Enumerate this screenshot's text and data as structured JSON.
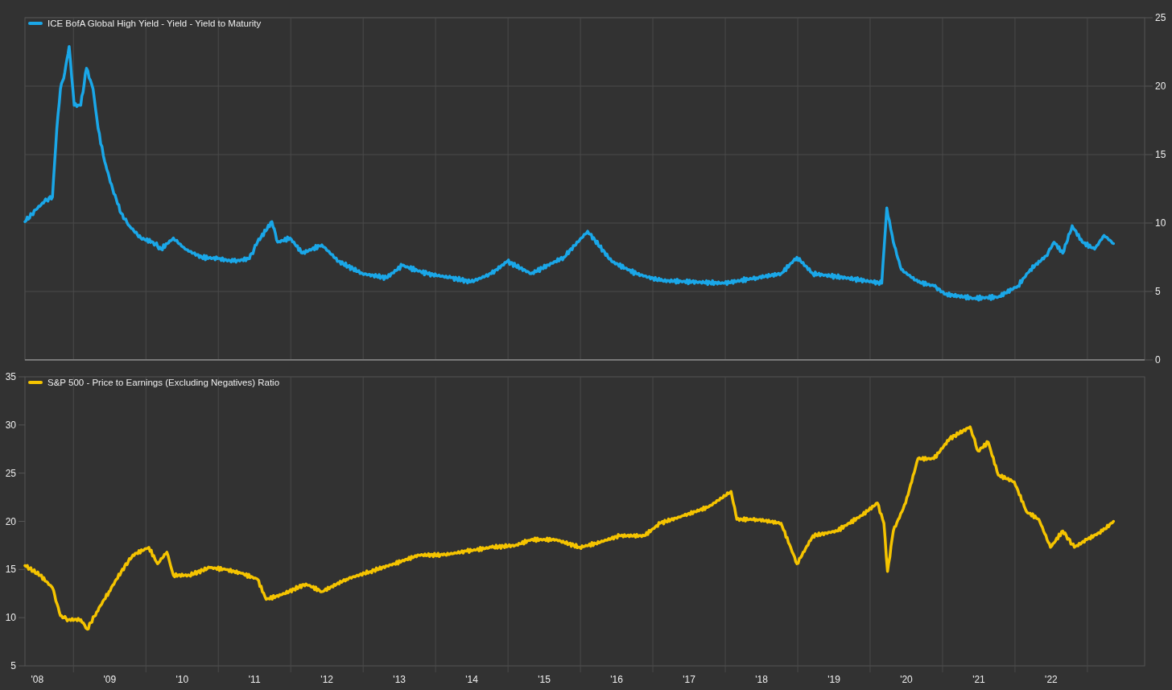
{
  "charts": [
    {
      "chart_data": {
        "type": "line",
        "grid": true,
        "xlim": [
          7.83,
          23.29
        ],
        "ylim": [
          0,
          25
        ],
        "yticks": [
          0,
          5,
          10,
          15,
          20,
          25
        ],
        "x": [
          7.83,
          7.99,
          8.1,
          8.21,
          8.27,
          8.32,
          8.38,
          8.44,
          8.51,
          8.6,
          8.68,
          8.77,
          8.84,
          8.93,
          9.04,
          9.16,
          9.27,
          9.43,
          9.6,
          9.71,
          9.88,
          10.04,
          10.27,
          10.49,
          10.71,
          10.93,
          11.04,
          11.24,
          11.32,
          11.49,
          11.66,
          11.93,
          12.16,
          12.49,
          12.82,
          13.04,
          13.38,
          13.71,
          13.99,
          14.27,
          14.49,
          14.82,
          15.27,
          15.6,
          15.93,
          16.27,
          16.6,
          17.04,
          17.49,
          17.93,
          18.27,
          18.49,
          18.71,
          19.16,
          19.66,
          19.73,
          19.82,
          19.93,
          20.16,
          20.38,
          20.54,
          20.93,
          21.27,
          21.54,
          21.71,
          21.93,
          22.04,
          22.16,
          22.29,
          22.43,
          22.6,
          22.73,
          22.86
        ],
        "series": [
          {
            "name": "ICE BofA Global High Yield - Yield - Yield to Maturity",
            "color": "#1aa7e8",
            "values": [
              10.1,
              11.0,
              11.6,
              11.9,
              16.9,
              19.8,
              21.0,
              22.9,
              18.6,
              18.6,
              21.3,
              19.8,
              16.9,
              14.5,
              12.5,
              10.7,
              9.8,
              8.9,
              8.6,
              8.1,
              8.9,
              8.1,
              7.5,
              7.4,
              7.2,
              7.4,
              8.6,
              10.1,
              8.6,
              8.9,
              7.8,
              8.4,
              7.2,
              6.3,
              6.0,
              6.9,
              6.3,
              6.0,
              5.7,
              6.3,
              7.2,
              6.3,
              7.5,
              9.4,
              7.2,
              6.3,
              5.8,
              5.7,
              5.6,
              6.0,
              6.3,
              7.5,
              6.3,
              6.0,
              5.6,
              11.1,
              8.6,
              6.6,
              5.7,
              5.4,
              4.8,
              4.5,
              4.6,
              5.4,
              6.6,
              7.6,
              8.6,
              7.8,
              9.8,
              8.6,
              8.1,
              9.1,
              8.5
            ]
          }
        ]
      }
    },
    {
      "chart_data": {
        "type": "line",
        "grid": true,
        "xlim": [
          7.83,
          23.29
        ],
        "ylim": [
          5,
          35
        ],
        "yticks": [
          5,
          10,
          15,
          20,
          25,
          30,
          35
        ],
        "xticks": [
          {
            "value": 8,
            "label": "'08"
          },
          {
            "value": 9,
            "label": "'09"
          },
          {
            "value": 10,
            "label": "'10"
          },
          {
            "value": 11,
            "label": "'11"
          },
          {
            "value": 12,
            "label": "'12"
          },
          {
            "value": 13,
            "label": "'13"
          },
          {
            "value": 14,
            "label": "'14"
          },
          {
            "value": 15,
            "label": "'15"
          },
          {
            "value": 16,
            "label": "'16"
          },
          {
            "value": 17,
            "label": "'17"
          },
          {
            "value": 18,
            "label": "'18"
          },
          {
            "value": 19,
            "label": "'19"
          },
          {
            "value": 20,
            "label": "'20"
          },
          {
            "value": 21,
            "label": "'21"
          },
          {
            "value": 22,
            "label": "'22"
          }
        ],
        "x": [
          7.83,
          8.04,
          8.21,
          8.32,
          8.43,
          8.6,
          8.69,
          8.82,
          8.99,
          9.16,
          9.32,
          9.54,
          9.66,
          9.79,
          9.88,
          10.1,
          10.38,
          10.6,
          10.82,
          11.04,
          11.16,
          11.38,
          11.71,
          11.93,
          12.27,
          12.6,
          12.93,
          13.27,
          13.6,
          13.93,
          14.27,
          14.6,
          14.82,
          15.16,
          15.49,
          15.71,
          16.04,
          16.38,
          16.6,
          16.93,
          17.27,
          17.58,
          17.66,
          17.93,
          18.27,
          18.49,
          18.71,
          19.04,
          19.38,
          19.6,
          19.69,
          19.74,
          19.82,
          19.99,
          20.16,
          20.38,
          20.6,
          20.88,
          20.99,
          21.13,
          21.27,
          21.49,
          21.66,
          21.83,
          21.99,
          22.16,
          22.32,
          22.49,
          22.71,
          22.86
        ],
        "series": [
          {
            "name": "S&P 500 - Price to Earnings (Excluding Negatives) Ratio",
            "color": "#f5c400",
            "values": [
              15.4,
              14.4,
              13.1,
              10.2,
              9.8,
              9.8,
              8.8,
              10.6,
              12.7,
              14.8,
              16.5,
              17.3,
              15.6,
              16.8,
              14.4,
              14.4,
              15.2,
              15.0,
              14.6,
              14.0,
              11.9,
              12.4,
              13.5,
              12.7,
              14.0,
              14.8,
              15.6,
              16.5,
              16.5,
              16.9,
              17.3,
              17.5,
              18.1,
              18.1,
              17.3,
              17.7,
              18.5,
              18.5,
              19.8,
              20.6,
              21.5,
              23.1,
              20.2,
              20.2,
              19.8,
              15.6,
              18.5,
              19.0,
              20.6,
              21.9,
              19.8,
              14.8,
              19.0,
              21.9,
              26.5,
              26.5,
              28.6,
              29.8,
              27.3,
              28.2,
              24.8,
              24.1,
              21.0,
              20.2,
              17.3,
              19.0,
              17.3,
              18.1,
              19.0,
              20.0
            ]
          }
        ]
      }
    }
  ]
}
